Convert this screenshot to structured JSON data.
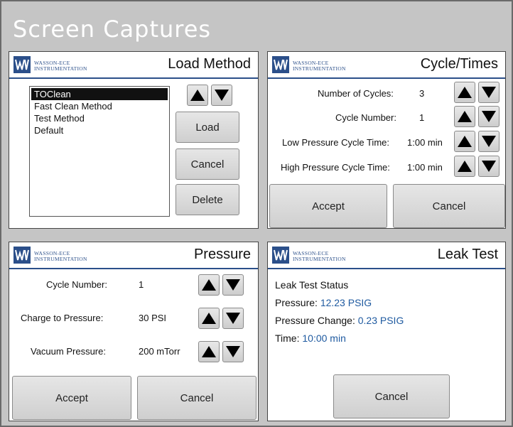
{
  "heading": "Screen Captures",
  "brand": {
    "line1": "WASSON-ECE",
    "line2": "INSTRUMENTATION",
    "color": "#2b4f8a"
  },
  "load_method": {
    "title": "Load Method",
    "items": [
      "TOClean",
      "Fast Clean Method",
      "Test Method",
      "Default"
    ],
    "selected_index": 0,
    "load_label": "Load",
    "cancel_label": "Cancel",
    "delete_label": "Delete"
  },
  "cycle_times": {
    "title": "Cycle/Times",
    "rows": [
      {
        "label": "Number of Cycles:",
        "value": "3"
      },
      {
        "label": "Cycle Number:",
        "value": "1"
      },
      {
        "label": "Low Pressure Cycle Time:",
        "value": "1:00 min"
      },
      {
        "label": "High Pressure Cycle Time:",
        "value": "1:00 min"
      }
    ],
    "accept_label": "Accept",
    "cancel_label": "Cancel"
  },
  "pressure": {
    "title": "Pressure",
    "rows": [
      {
        "label": "Cycle Number:",
        "value": "1"
      },
      {
        "label": "Charge to Pressure:",
        "value": "30 PSI"
      },
      {
        "label": "Vacuum Pressure:",
        "value": "200 mTorr"
      }
    ],
    "accept_label": "Accept",
    "cancel_label": "Cancel"
  },
  "leak_test": {
    "title": "Leak Test",
    "status_label": "Leak Test Status",
    "pressure_label": "Pressure:",
    "pressure_value": "12.23 PSIG",
    "change_label": "Pressure Change:",
    "change_value": "0.23 PSIG",
    "time_label": "Time:",
    "time_value": "10:00 min",
    "cancel_label": "Cancel",
    "value_color": "#1f5aa0"
  }
}
